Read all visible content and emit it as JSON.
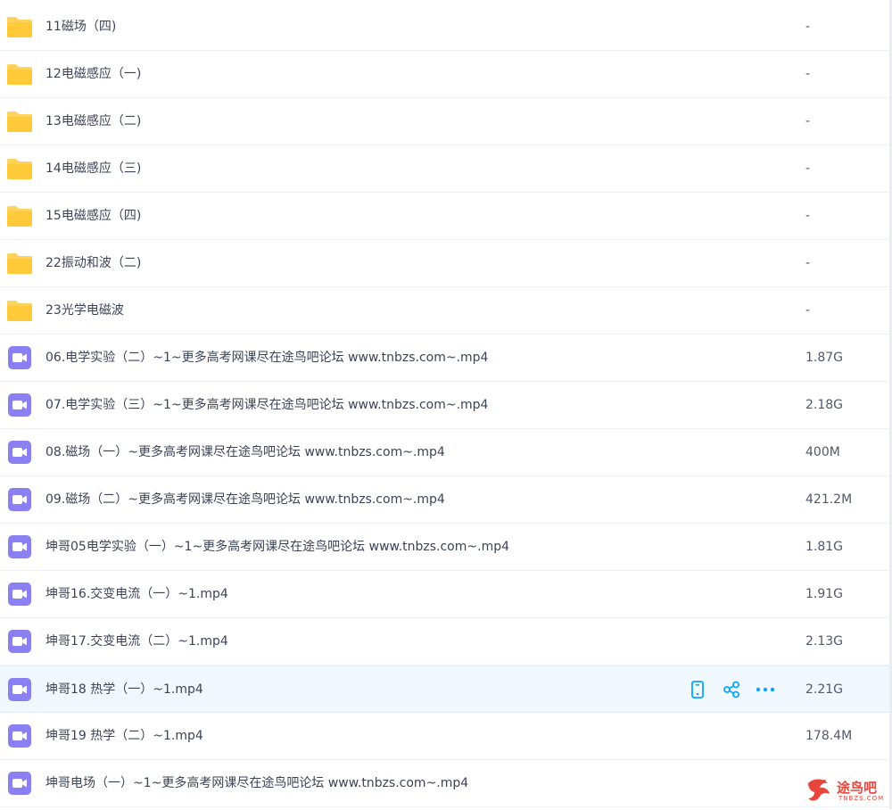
{
  "files": [
    {
      "type": "folder",
      "name": "11磁场（四)",
      "size": "-"
    },
    {
      "type": "folder",
      "name": "12电磁感应（一)",
      "size": "-"
    },
    {
      "type": "folder",
      "name": "13电磁感应（二)",
      "size": "-"
    },
    {
      "type": "folder",
      "name": "14电磁感应（三)",
      "size": "-"
    },
    {
      "type": "folder",
      "name": "15电磁感应（四)",
      "size": "-"
    },
    {
      "type": "folder",
      "name": "22振动和波（二)",
      "size": "-"
    },
    {
      "type": "folder",
      "name": "23光学电磁波",
      "size": "-"
    },
    {
      "type": "video",
      "name": "06.电学实验（二）~1~更多高考网课尽在途鸟吧论坛 www.tnbzs.com~.mp4",
      "size": "1.87G"
    },
    {
      "type": "video",
      "name": "07.电学实验（三）~1~更多高考网课尽在途鸟吧论坛 www.tnbzs.com~.mp4",
      "size": "2.18G"
    },
    {
      "type": "video",
      "name": "08.磁场（一）~更多高考网课尽在途鸟吧论坛 www.tnbzs.com~.mp4",
      "size": "400M"
    },
    {
      "type": "video",
      "name": "09.磁场（二）~更多高考网课尽在途鸟吧论坛 www.tnbzs.com~.mp4",
      "size": "421.2M"
    },
    {
      "type": "video",
      "name": "坤哥05电学实验（一）~1~更多高考网课尽在途鸟吧论坛 www.tnbzs.com~.mp4",
      "size": "1.81G"
    },
    {
      "type": "video",
      "name": "坤哥16.交变电流（一）~1.mp4",
      "size": "1.91G"
    },
    {
      "type": "video",
      "name": "坤哥17.交变电流（二）~1.mp4",
      "size": "2.13G"
    },
    {
      "type": "video",
      "name": "坤哥18 热学（一）~1.mp4",
      "size": "2.21G",
      "hovered": true
    },
    {
      "type": "video",
      "name": "坤哥19 热学（二）~1.mp4",
      "size": "178.4M"
    },
    {
      "type": "video",
      "name": "坤哥电场（一）~1~更多高考网课尽在途鸟吧论坛 www.tnbzs.com~.mp4",
      "size": ""
    }
  ],
  "row_actions": [
    {
      "name": "phone-icon"
    },
    {
      "name": "share-icon"
    },
    {
      "name": "more-icon"
    }
  ],
  "watermark": {
    "text": "途鸟吧",
    "sub": "TNBZS.COM"
  },
  "colors": {
    "folder": "#ffca3a",
    "video": "#8a80f2",
    "accent": "#06a7ff",
    "hover_bg": "#f2f8ff"
  }
}
